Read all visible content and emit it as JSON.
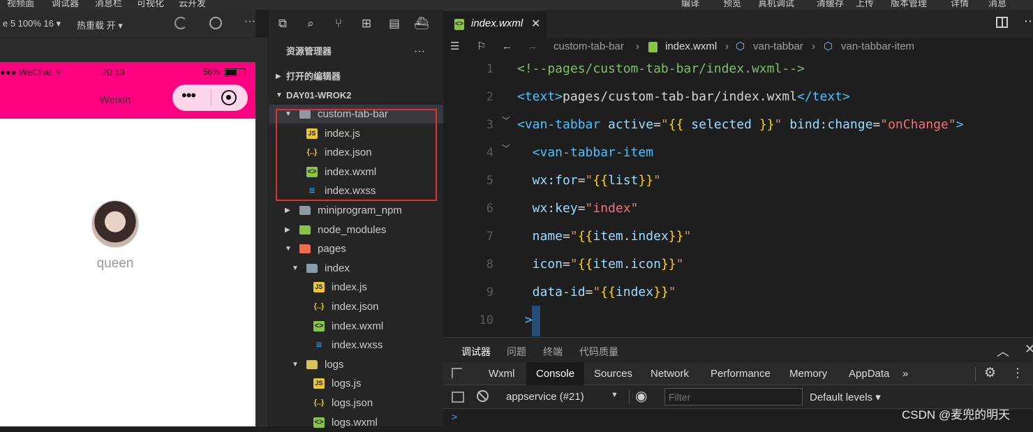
{
  "top_menu": [
    "视频面",
    "调试器",
    "消息栏",
    "可视化",
    "云开发"
  ],
  "right_menu": [
    "编译",
    "预览",
    "真机调试",
    "清缓存",
    "上传",
    "版本管理",
    "详情",
    "消息"
  ],
  "simulator": {
    "device_label": "e 5 100% 16 ▾",
    "hot_reload": "热重载 开 ▾",
    "status_left": "●●● WeChat",
    "status_time": "20:13",
    "status_battery": "56%",
    "nav_title": "Weixin",
    "capsule_dots": "•••",
    "user_name": "queen",
    "nav_color": "#ff0080"
  },
  "explorer": {
    "title": "资源管理器",
    "more": "···",
    "open_editors": "打开的编辑器",
    "project": "DAY01-WROK2",
    "tree": [
      {
        "label": "custom-tab-bar",
        "type": "folder",
        "open": true,
        "indent": 0
      },
      {
        "label": "index.js",
        "type": "js",
        "indent": 1
      },
      {
        "label": "index.json",
        "type": "json",
        "indent": 1
      },
      {
        "label": "index.wxml",
        "type": "wxml",
        "indent": 1
      },
      {
        "label": "index.wxss",
        "type": "wxss",
        "indent": 1
      },
      {
        "label": "miniprogram_npm",
        "type": "folder",
        "open": false,
        "indent": 0
      },
      {
        "label": "node_modules",
        "type": "node",
        "open": false,
        "indent": 0
      },
      {
        "label": "pages",
        "type": "pagesfolder",
        "open": true,
        "indent": 0
      },
      {
        "label": "index",
        "type": "folder",
        "open": true,
        "indent": 1
      },
      {
        "label": "index.js",
        "type": "js",
        "indent": 2
      },
      {
        "label": "index.json",
        "type": "json",
        "indent": 2
      },
      {
        "label": "index.wxml",
        "type": "wxml",
        "indent": 2
      },
      {
        "label": "index.wxss",
        "type": "wxss",
        "indent": 2
      },
      {
        "label": "logs",
        "type": "logsfolder",
        "open": true,
        "indent": 1
      },
      {
        "label": "logs.js",
        "type": "js",
        "indent": 2
      },
      {
        "label": "logs.json",
        "type": "json",
        "indent": 2
      },
      {
        "label": "logs.wxml",
        "type": "wxml",
        "indent": 2
      }
    ]
  },
  "editor": {
    "tab_label": "index.wxml",
    "tab_close": "✕",
    "breadcrumb": [
      "custom-tab-bar",
      "index.wxml",
      "van-tabbar",
      "van-tabbar-item"
    ],
    "lines": [
      {
        "n": "1",
        "segs": [
          [
            "cm",
            "<!--pages/custom-tab-bar/index.wxml-->"
          ]
        ]
      },
      {
        "n": "2",
        "segs": [
          [
            "tg",
            "<text>"
          ],
          [
            "wt",
            "pages/custom-tab-bar/index.wxml"
          ],
          [
            "tg",
            "</text>"
          ]
        ]
      },
      {
        "n": "3",
        "fold": true,
        "segs": [
          [
            "tg",
            "<van-tabbar "
          ],
          [
            "at",
            "active"
          ],
          [
            "wt",
            "="
          ],
          [
            "st",
            "\""
          ],
          [
            "br",
            "{{"
          ],
          [
            "at",
            " selected "
          ],
          [
            "br",
            "}}"
          ],
          [
            "st",
            "\""
          ],
          [
            "at",
            " bind:change"
          ],
          [
            "wt",
            "="
          ],
          [
            "st",
            "\""
          ],
          [
            "or",
            "onChange"
          ],
          [
            "st",
            "\""
          ],
          [
            "tg",
            ">"
          ]
        ]
      },
      {
        "n": "4",
        "fold": true,
        "segs": [
          [
            "tg",
            "  <van-tabbar-item"
          ]
        ]
      },
      {
        "n": "5",
        "segs": [
          [
            "at",
            "  wx:for"
          ],
          [
            "wt",
            "="
          ],
          [
            "st",
            "\""
          ],
          [
            "br",
            "{{"
          ],
          [
            "at",
            "list"
          ],
          [
            "br",
            "}}"
          ],
          [
            "st",
            "\""
          ]
        ]
      },
      {
        "n": "6",
        "segs": [
          [
            "at",
            "  wx:key"
          ],
          [
            "wt",
            "="
          ],
          [
            "st",
            "\""
          ],
          [
            "or",
            "index"
          ],
          [
            "st",
            "\""
          ]
        ]
      },
      {
        "n": "7",
        "segs": [
          [
            "at",
            "  name"
          ],
          [
            "wt",
            "="
          ],
          [
            "st",
            "\""
          ],
          [
            "br",
            "{{"
          ],
          [
            "at",
            "item.index"
          ],
          [
            "br",
            "}}"
          ],
          [
            "st",
            "\""
          ]
        ]
      },
      {
        "n": "8",
        "segs": [
          [
            "at",
            "  icon"
          ],
          [
            "wt",
            "="
          ],
          [
            "st",
            "\""
          ],
          [
            "br",
            "{{"
          ],
          [
            "at",
            "item.icon"
          ],
          [
            "br",
            "}}"
          ],
          [
            "st",
            "\""
          ]
        ]
      },
      {
        "n": "9",
        "segs": [
          [
            "at",
            "  data-id"
          ],
          [
            "wt",
            "="
          ],
          [
            "st",
            "\""
          ],
          [
            "br",
            "{{"
          ],
          [
            "at",
            "index"
          ],
          [
            "br",
            "}}"
          ],
          [
            "st",
            "\""
          ]
        ]
      },
      {
        "n": "10",
        "segs": [
          [
            "tg",
            " >"
          ]
        ]
      }
    ]
  },
  "panel": {
    "tabs": [
      "调试器",
      "问题",
      "终端",
      "代码质量"
    ],
    "devtools_tabs": [
      "Wxml",
      "Console",
      "Sources",
      "Network",
      "Performance",
      "Memory",
      "AppData"
    ],
    "more_tabs": "»",
    "context": "appservice (#21)",
    "filter_placeholder": "Filter",
    "levels": "Default levels ▾",
    "prompt": ">"
  },
  "watermark": "CSDN @麦兜的明天"
}
